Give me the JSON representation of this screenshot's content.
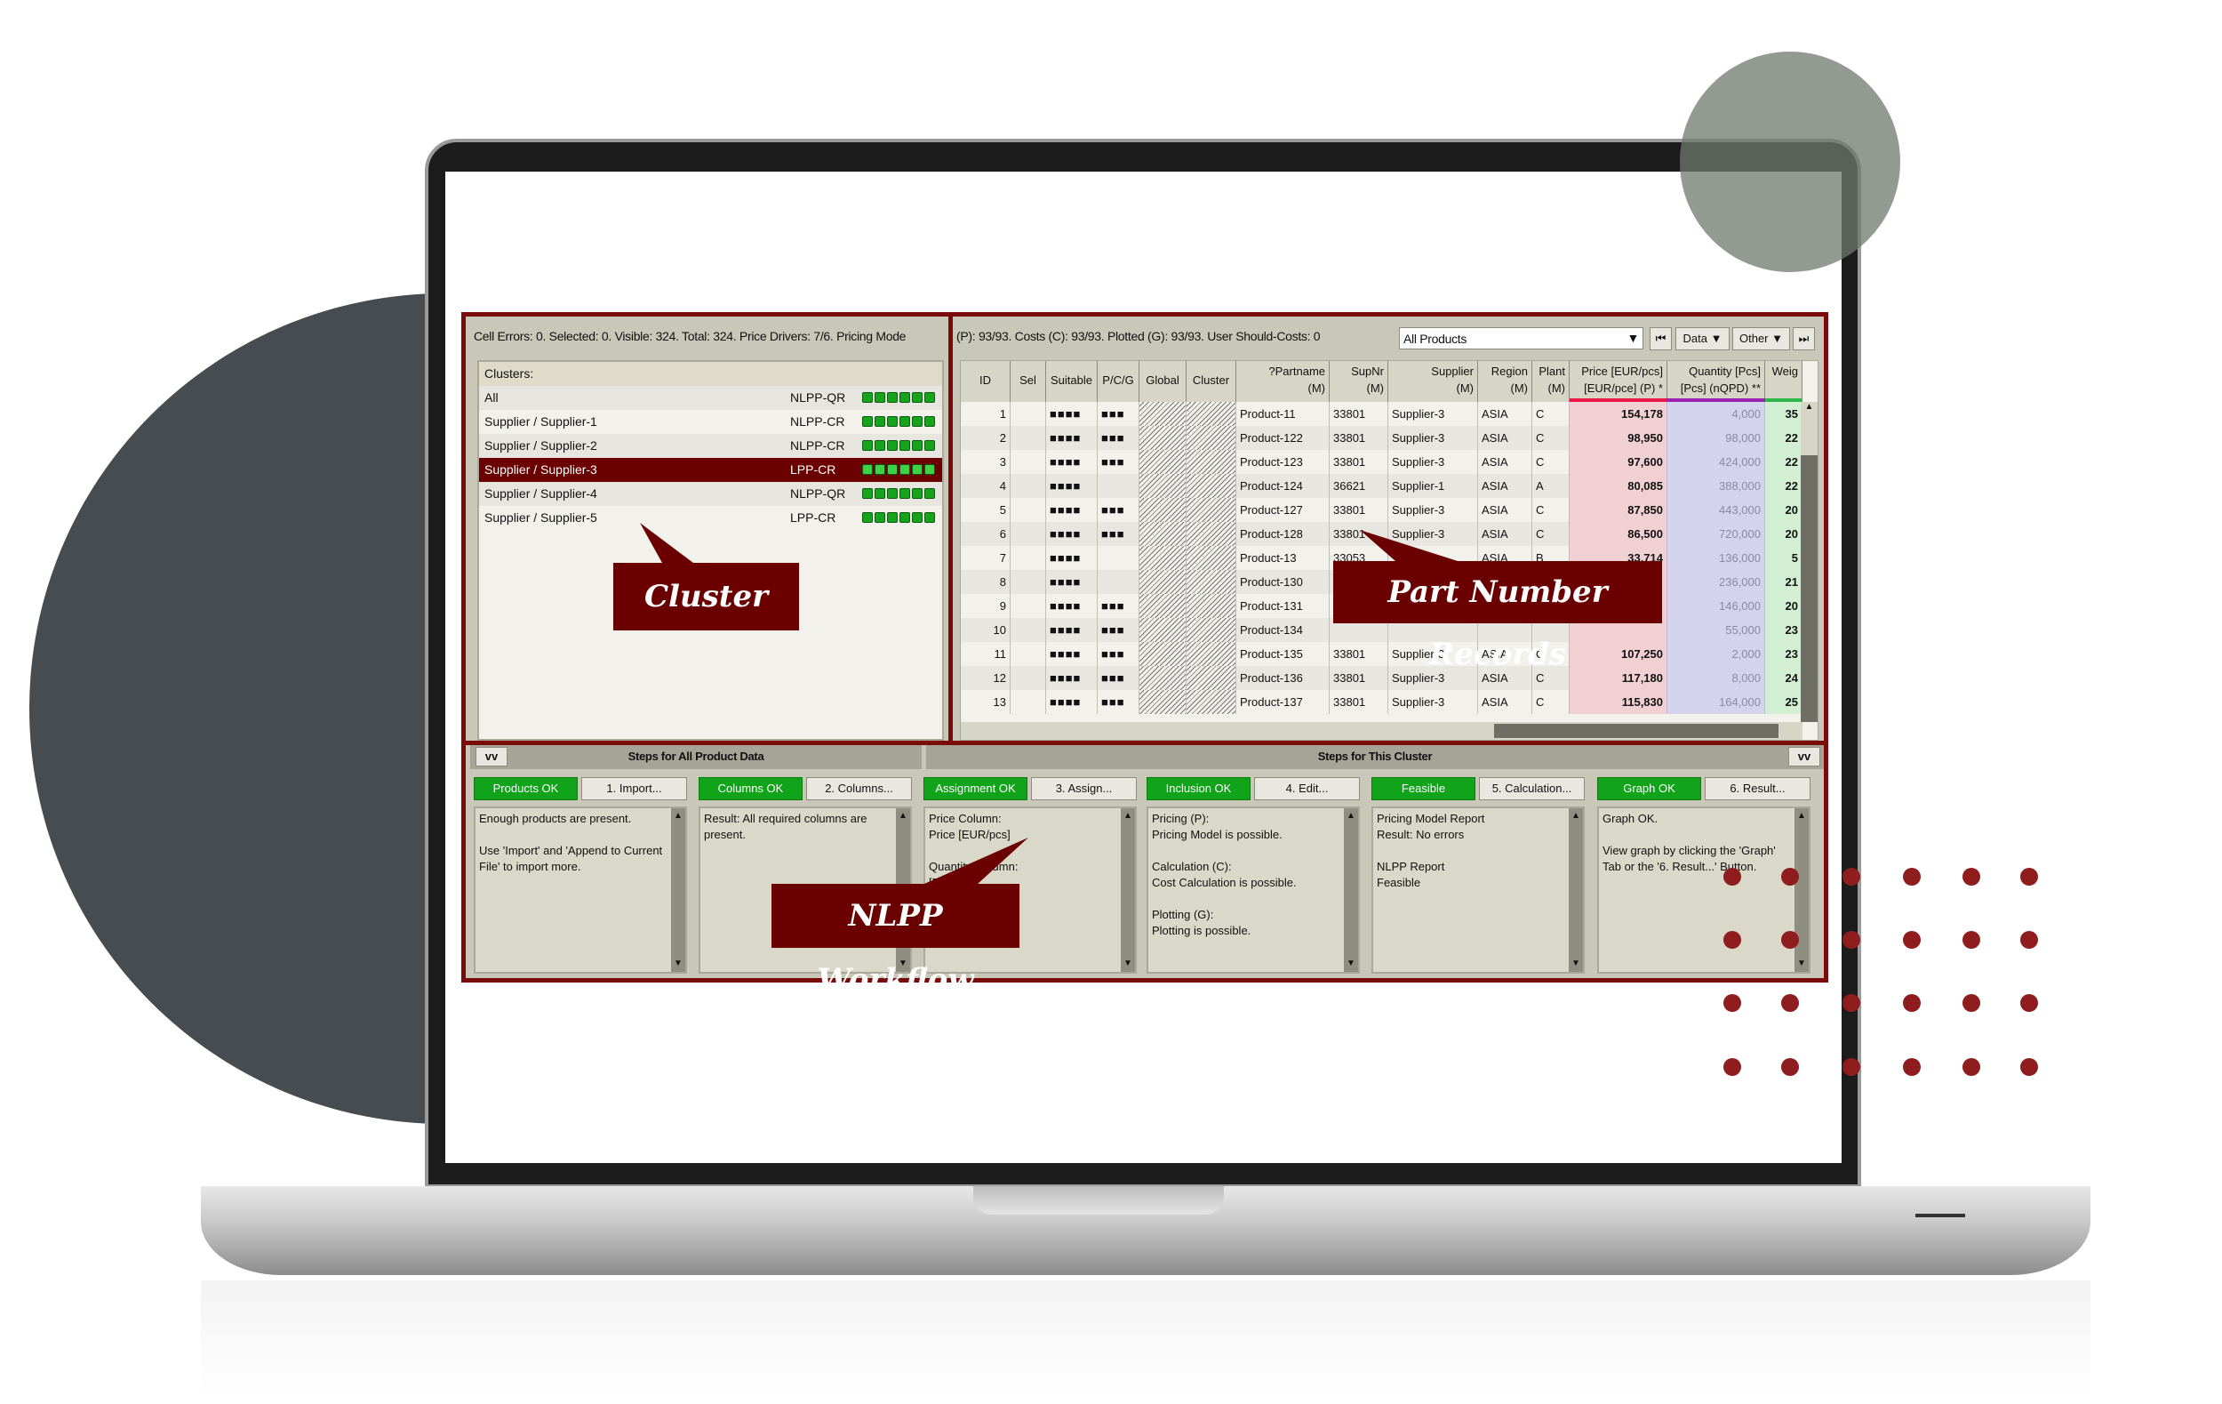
{
  "status_left": "Cell Errors: 0. Selected: 0. Visible: 324. Total: 324. Price Drivers: 7/6. Pricing Mode",
  "status_right": "(P): 93/93. Costs (C): 93/93. Plotted (G): 93/93. User Should-Costs: 0",
  "filter": {
    "selected": "All Products"
  },
  "toolbar": {
    "first": "⏮",
    "data": "Data ▼",
    "other": "Other ▼",
    "last": "⏭"
  },
  "clusters": {
    "header": "Clusters:",
    "items": [
      {
        "name": "All",
        "model": "NLPP-QR"
      },
      {
        "name": "Supplier / Supplier-1",
        "model": "NLPP-CR"
      },
      {
        "name": "Supplier / Supplier-2",
        "model": "NLPP-CR"
      },
      {
        "name": "Supplier / Supplier-3",
        "model": "LPP-CR",
        "selected": true
      },
      {
        "name": "Supplier / Supplier-4",
        "model": "NLPP-QR"
      },
      {
        "name": "Supplier / Supplier-5",
        "model": "LPP-CR"
      }
    ]
  },
  "columns": [
    "ID",
    "Sel",
    "Suitable",
    "P/C/G",
    "Global",
    "Cluster",
    "?Partname\n(M)",
    "SupNr\n(M)",
    "Supplier\n(M)",
    "Region\n(M)",
    "Plant\n(M)",
    "Price [EUR/pcs]\n[EUR/pce] (P) *",
    "Quantity [Pcs]\n[Pcs] (nQPD) **",
    "Weig"
  ],
  "rows": [
    [
      "1",
      "",
      "■■■■",
      "■■■",
      "",
      "",
      "Product-11",
      "33801",
      "Supplier-3",
      "ASIA",
      "C",
      "154,178",
      "4,000",
      "35"
    ],
    [
      "2",
      "",
      "■■■■",
      "■■■",
      "",
      "",
      "Product-122",
      "33801",
      "Supplier-3",
      "ASIA",
      "C",
      "98,950",
      "98,000",
      "22"
    ],
    [
      "3",
      "",
      "■■■■",
      "■■■",
      "",
      "",
      "Product-123",
      "33801",
      "Supplier-3",
      "ASIA",
      "C",
      "97,600",
      "424,000",
      "22"
    ],
    [
      "4",
      "",
      "■■■■",
      "",
      "",
      "",
      "Product-124",
      "36621",
      "Supplier-1",
      "ASIA",
      "A",
      "80,085",
      "388,000",
      "22"
    ],
    [
      "5",
      "",
      "■■■■",
      "■■■",
      "",
      "",
      "Product-127",
      "33801",
      "Supplier-3",
      "ASIA",
      "C",
      "87,850",
      "443,000",
      "20"
    ],
    [
      "6",
      "",
      "■■■■",
      "■■■",
      "",
      "",
      "Product-128",
      "33801",
      "Supplier-3",
      "ASIA",
      "C",
      "86,500",
      "720,000",
      "20"
    ],
    [
      "7",
      "",
      "■■■■",
      "",
      "",
      "",
      "Product-13",
      "33053",
      "",
      "ASIA",
      "B",
      "33,714",
      "136,000",
      "5"
    ],
    [
      "8",
      "",
      "■■■■",
      "",
      "",
      "",
      "Product-130",
      "",
      "",
      "",
      "",
      "",
      "236,000",
      "21"
    ],
    [
      "9",
      "",
      "■■■■",
      "■■■",
      "",
      "",
      "Product-131",
      "",
      "",
      "",
      "",
      "",
      "146,000",
      "20"
    ],
    [
      "10",
      "",
      "■■■■",
      "■■■",
      "",
      "",
      "Product-134",
      "",
      "",
      "",
      "",
      "",
      "55,000",
      "23"
    ],
    [
      "11",
      "",
      "■■■■",
      "■■■",
      "",
      "",
      "Product-135",
      "33801",
      "Supplier-3",
      "ASIA",
      "C",
      "107,250",
      "2,000",
      "23"
    ],
    [
      "12",
      "",
      "■■■■",
      "■■■",
      "",
      "",
      "Product-136",
      "33801",
      "Supplier-3",
      "ASIA",
      "C",
      "117,180",
      "8,000",
      "24"
    ],
    [
      "13",
      "",
      "■■■■",
      "■■■",
      "",
      "",
      "Product-137",
      "33801",
      "Supplier-3",
      "ASIA",
      "C",
      "115,830",
      "164,000",
      "25"
    ]
  ],
  "steps": {
    "all_title": "Steps for All Product Data",
    "cluster_title": "Steps for This Cluster",
    "collapse": "vv",
    "items": [
      {
        "status": "Products OK",
        "action": "1. Import...",
        "text": "Enough products are present.\n\nUse 'Import' and 'Append to Current File' to import more."
      },
      {
        "status": "Columns OK",
        "action": "2. Columns...",
        "text": "Result: All required columns are present."
      },
      {
        "status": "Assignment OK",
        "action": "3. Assign...",
        "text": "Price Column:\nPrice [EUR/pcs]\n\nQuantity Column:\n[Pcs]"
      },
      {
        "status": "Inclusion OK",
        "action": "4. Edit...",
        "text": "Pricing (P):\nPricing Model is possible.\n\nCalculation (C):\nCost Calculation is possible.\n\nPlotting (G):\nPlotting is possible."
      },
      {
        "status": "Feasible",
        "action": "5. Calculation...",
        "text": "Pricing Model Report\nResult: No errors\n\nNLPP Report\nFeasible"
      },
      {
        "status": "Graph OK",
        "action": "6. Result...",
        "text": "Graph OK.\n\nView graph by clicking the 'Graph' Tab or the '6. Result...' Button."
      }
    ]
  },
  "callouts": {
    "cluster": "Cluster",
    "records": "Part Number Records",
    "workflow": "NLPP Workflow"
  },
  "colors": {
    "brand": "#6b0000",
    "ok": "#11a31a",
    "price_col": "#f0d0d3",
    "qty_col": "#d3d3ee",
    "weight_col": "#d3efd3"
  }
}
